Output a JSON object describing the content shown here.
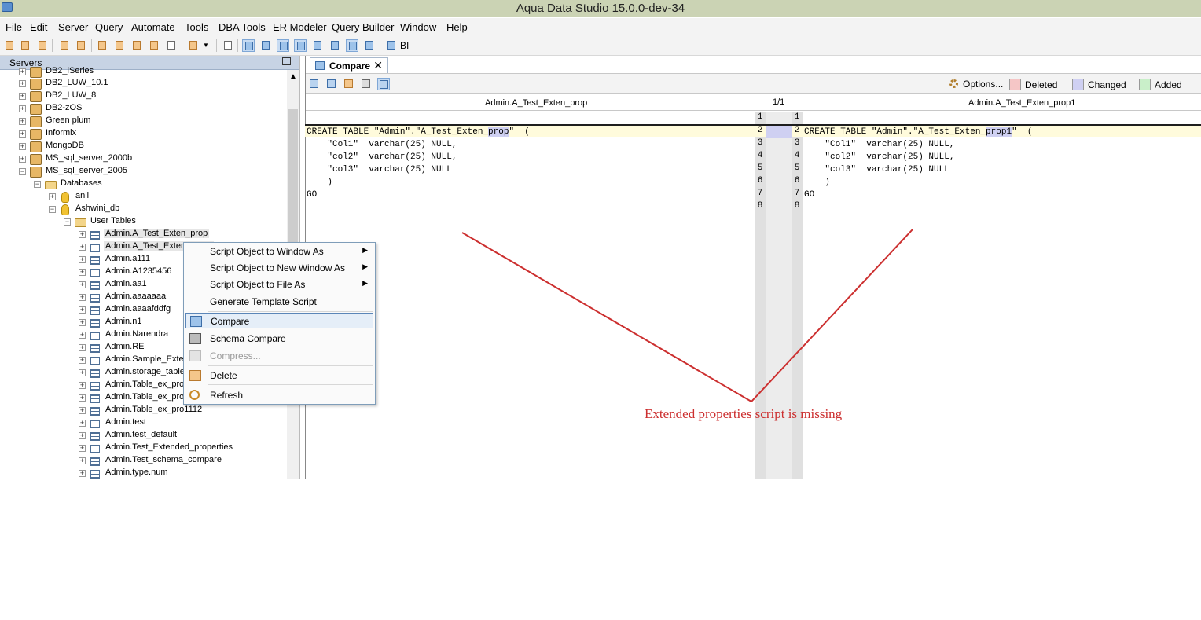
{
  "window": {
    "title": "Aqua Data Studio 15.0.0-dev-34",
    "minimize": "–"
  },
  "menubar": [
    "File",
    "Edit",
    "Server",
    "Query",
    "Automate",
    "Tools",
    "DBA Tools",
    "ER Modeler",
    "Query Builder",
    "Window",
    "Help"
  ],
  "toolbar": {
    "bi_label": "BI"
  },
  "servers_panel": {
    "title": "Servers",
    "items": [
      {
        "label": "DB2_iSeries",
        "expander": "+"
      },
      {
        "label": "DB2_LUW_10.1",
        "expander": "+"
      },
      {
        "label": "DB2_LUW_8",
        "expander": "+"
      },
      {
        "label": "DB2-zOS",
        "expander": "+"
      },
      {
        "label": "Green plum",
        "expander": "+"
      },
      {
        "label": "Informix",
        "expander": "+"
      },
      {
        "label": "MongoDB",
        "expander": "+"
      },
      {
        "label": "MS_sql_server_2000b",
        "expander": "+"
      },
      {
        "label": "MS_sql_server_2005",
        "expander": "−"
      },
      {
        "label": "Databases",
        "expander": "−"
      },
      {
        "label": "anil",
        "expander": "+"
      },
      {
        "label": "Ashwini_db",
        "expander": "−"
      },
      {
        "label": "User Tables",
        "expander": "−"
      },
      {
        "label": "Admin.A_Test_Exten_prop",
        "expander": "+"
      },
      {
        "label": "Admin.A_Test_Exten_prop1",
        "expander": "+"
      },
      {
        "label": "Admin.a111",
        "expander": "+"
      },
      {
        "label": "Admin.A1235456",
        "expander": "+"
      },
      {
        "label": "Admin.aa1",
        "expander": "+"
      },
      {
        "label": "Admin.aaaaaaa",
        "expander": "+"
      },
      {
        "label": "Admin.aaaafddfg",
        "expander": "+"
      },
      {
        "label": "Admin.n1",
        "expander": "+"
      },
      {
        "label": "Admin.Narendra",
        "expander": "+"
      },
      {
        "label": "Admin.RE",
        "expander": "+"
      },
      {
        "label": "Admin.Sample_Extended",
        "expander": "+"
      },
      {
        "label": "Admin.storage_table",
        "expander": "+"
      },
      {
        "label": "Admin.Table_ex_pro",
        "expander": "+"
      },
      {
        "label": "Admin.Table_ex_pro1",
        "expander": "+"
      },
      {
        "label": "Admin.Table_ex_pro1112",
        "expander": "+"
      },
      {
        "label": "Admin.test",
        "expander": "+"
      },
      {
        "label": "Admin.test_default",
        "expander": "+"
      },
      {
        "label": "Admin.Test_Extended_properties",
        "expander": "+"
      },
      {
        "label": "Admin.Test_schema_compare",
        "expander": "+"
      },
      {
        "label": "Admin.type.num",
        "expander": "+"
      }
    ]
  },
  "context_menu": {
    "items": [
      {
        "label": "Script Object to Window As",
        "submenu": "▶"
      },
      {
        "label": "Script Object to New Window As",
        "submenu": "▶"
      },
      {
        "label": "Script Object to File As",
        "submenu": "▶"
      },
      {
        "label": "Generate Template Script"
      },
      {
        "label": "Compare"
      },
      {
        "label": "Schema Compare"
      },
      {
        "label": "Compress..."
      },
      {
        "label": "Delete"
      },
      {
        "label": "Refresh"
      }
    ]
  },
  "compare": {
    "tab_label": "Compare",
    "tab_close": "✕",
    "options_label": "Options...",
    "legend": [
      {
        "label": "Deleted",
        "color": "#f5c6c6"
      },
      {
        "label": "Changed",
        "color": "#cfd0f2"
      },
      {
        "label": "Added",
        "color": "#c9efc9"
      }
    ],
    "left_title": "Admin.A_Test_Exten_prop",
    "right_title": "Admin.A_Test_Exten_prop1",
    "counter": "1/1",
    "line_numbers": [
      "1",
      "2",
      "3",
      "4",
      "5",
      "6",
      "7",
      "8"
    ],
    "left_code": {
      "l2_pre": "CREATE TABLE \"Admin\".\"A_Test_Exten_",
      "l2_hl": "prop",
      "l2_post": "\"  (",
      "l3": "    \"Col1\"  varchar(25) NULL,",
      "l4": "    \"col2\"  varchar(25) NULL,",
      "l5": "    \"col3\"  varchar(25) NULL",
      "l6": "    )",
      "l7": "GO"
    },
    "right_code": {
      "l2_pre": "CREATE TABLE \"Admin\".\"A_Test_Exten_",
      "l2_hl": "prop1",
      "l2_post": "\"  (",
      "l3": "    \"Col1\"  varchar(25) NULL,",
      "l4": "    \"col2\"  varchar(25) NULL,",
      "l5": "    \"col3\"  varchar(25) NULL",
      "l6": "    )",
      "l7": "GO"
    }
  },
  "annotation": {
    "text": "Extended properties script is missing",
    "color": "#cc2f2f"
  }
}
